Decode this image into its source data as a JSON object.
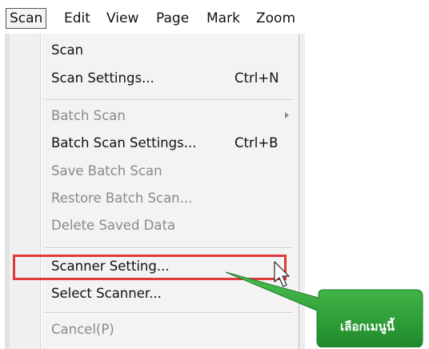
{
  "menubar": {
    "items": [
      {
        "label": "Scan",
        "active": true
      },
      {
        "label": "Edit"
      },
      {
        "label": "View"
      },
      {
        "label": "Page"
      },
      {
        "label": "Mark"
      },
      {
        "label": "Zoom"
      }
    ]
  },
  "menu": {
    "items": [
      {
        "label": "Scan",
        "enabled": true
      },
      {
        "label": "Scan Settings...",
        "shortcut": "Ctrl+N",
        "enabled": true
      },
      {
        "label": "Batch Scan",
        "enabled": false,
        "has_submenu": true
      },
      {
        "label": "Batch Scan Settings...",
        "shortcut": "Ctrl+B",
        "enabled": true
      },
      {
        "label": "Save Batch Scan",
        "enabled": false
      },
      {
        "label": "Restore Batch Scan...",
        "enabled": false
      },
      {
        "label": "Delete Saved Data",
        "enabled": false
      },
      {
        "label": "Scanner Setting...",
        "enabled": true,
        "highlighted": true
      },
      {
        "label": "Select Scanner...",
        "enabled": true
      },
      {
        "label": "Cancel(P)",
        "enabled": false
      }
    ]
  },
  "callout": {
    "text": "เลือกเมนูนี้",
    "color": "#2aa23a"
  },
  "colors": {
    "highlight_border": "#e03a3a",
    "disabled_text": "#8a8a8a"
  }
}
